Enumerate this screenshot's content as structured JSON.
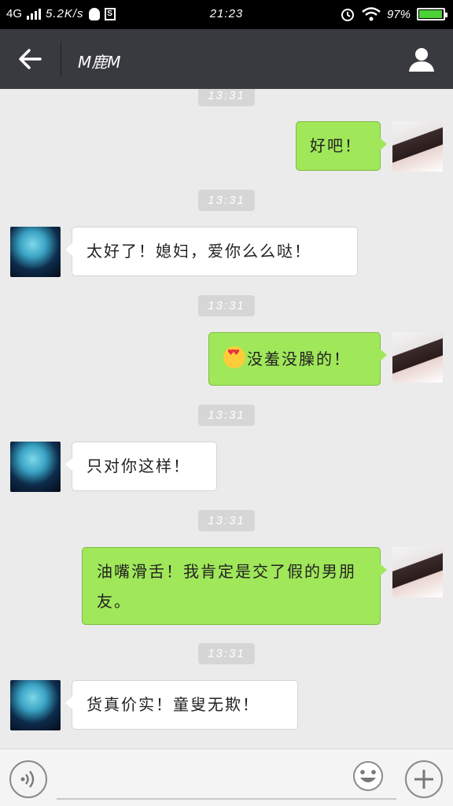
{
  "status_bar": {
    "network": "4G",
    "speed": "5.2K/s",
    "time": "21:23",
    "battery": "97%",
    "battery_level": 0.97,
    "icons": [
      "signal-icon",
      "qq-icon",
      "s-icon",
      "alarm-icon",
      "wifi-icon",
      "battery-icon"
    ]
  },
  "header": {
    "title": "M鹿M",
    "back_icon": "back-arrow-icon",
    "profile_icon": "person-icon"
  },
  "messages": [
    {
      "type": "timestamp",
      "text": "13:31"
    },
    {
      "type": "message",
      "from": "me",
      "text": "好吧！"
    },
    {
      "type": "timestamp",
      "text": "13:31"
    },
    {
      "type": "message",
      "from": "friend",
      "text": "太好了！媳妇，爱你么么哒！"
    },
    {
      "type": "timestamp",
      "text": "13:31"
    },
    {
      "type": "message",
      "from": "me",
      "text": "没羞没臊的！",
      "emoji": "heart-eyes-emoji"
    },
    {
      "type": "timestamp",
      "text": "13:31"
    },
    {
      "type": "message",
      "from": "friend",
      "text": "只对你这样！"
    },
    {
      "type": "timestamp",
      "text": "13:31"
    },
    {
      "type": "message",
      "from": "me",
      "text": "油嘴滑舌！我肯定是交了假的男朋友。"
    },
    {
      "type": "timestamp",
      "text": "13:31"
    },
    {
      "type": "message",
      "from": "friend",
      "text": "货真价实！童叟无欺！"
    }
  ],
  "input_bar": {
    "voice_icon": "voice-icon",
    "text_value": "",
    "emoji_icon": "smiley-icon",
    "plus_icon": "plus-icon"
  },
  "colors": {
    "status_bar": "#000000",
    "header": "#393a3f",
    "background": "#ebebeb",
    "outgoing_bubble": "#a0e75a",
    "incoming_bubble": "#ffffff",
    "timestamp_chip": "#d6d6d6"
  }
}
